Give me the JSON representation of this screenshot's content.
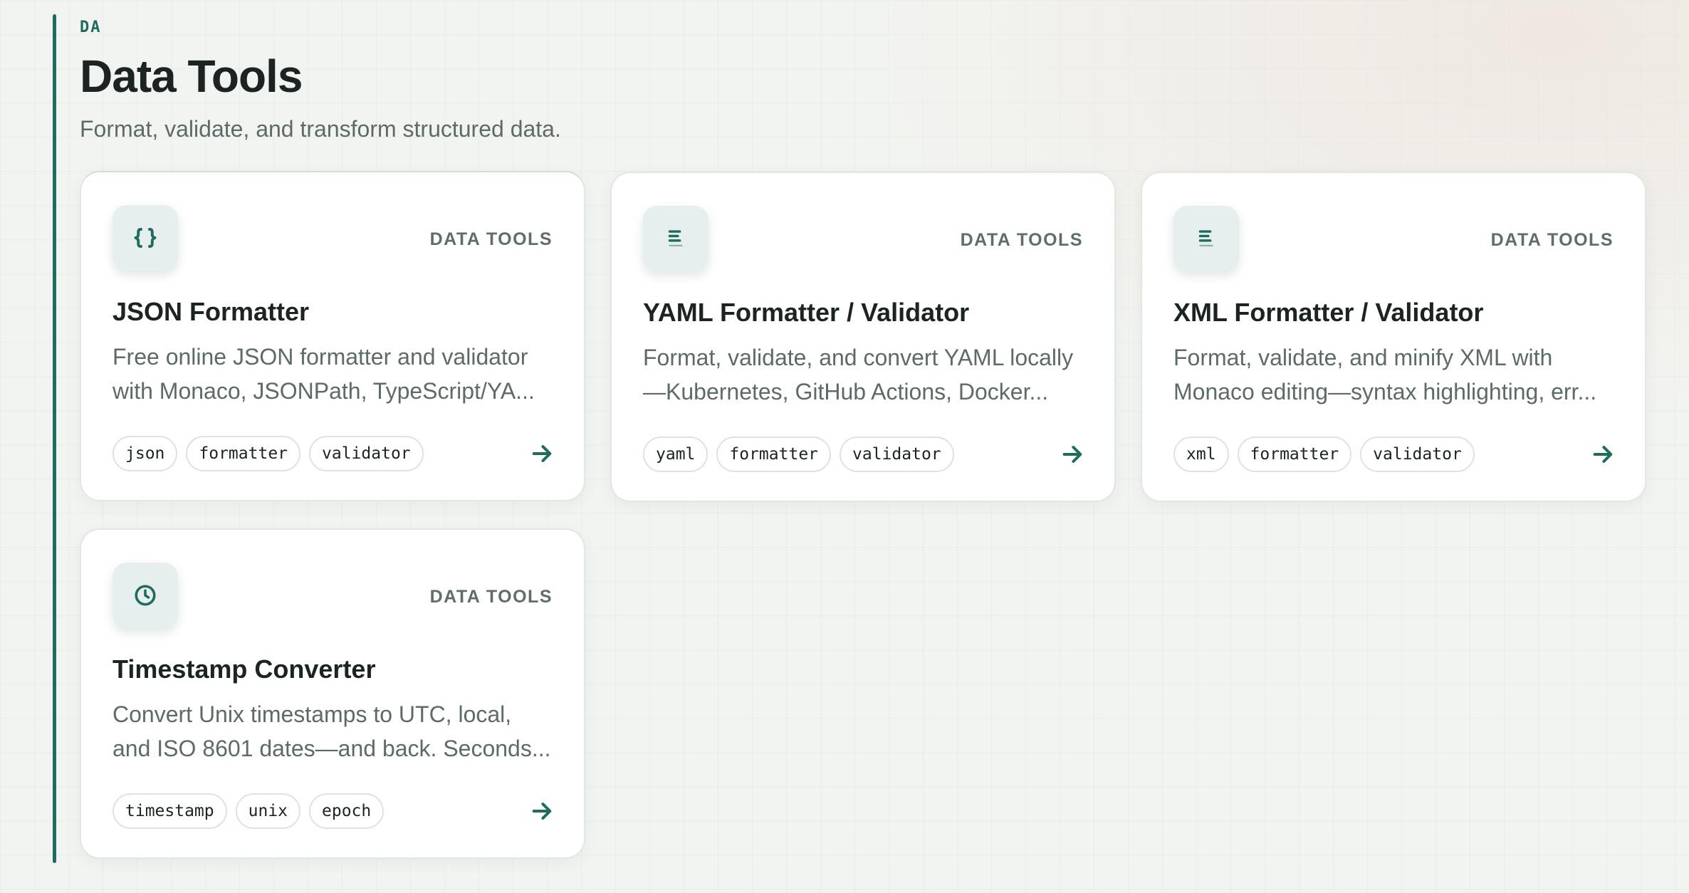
{
  "section": {
    "kicker": "DA",
    "title": "Data Tools",
    "subtitle": "Format, validate, and transform structured data."
  },
  "colors": {
    "accent": "#1f6b5e",
    "icon_bg": "#e6efed",
    "text_muted": "#5d6b66"
  },
  "cards": [
    {
      "icon": "braces-icon",
      "category": "DATA TOOLS",
      "title": "JSON Formatter",
      "description": [
        "Free online JSON formatter and validator",
        "with Monaco, JSONPath, TypeScript/YA..."
      ],
      "tags": [
        "json",
        "formatter",
        "validator"
      ]
    },
    {
      "icon": "list-lines-icon",
      "category": "DATA TOOLS",
      "title": "YAML Formatter / Validator",
      "description": [
        "Format, validate, and convert YAML locally",
        "—Kubernetes, GitHub Actions, Docker..."
      ],
      "tags": [
        "yaml",
        "formatter",
        "validator"
      ]
    },
    {
      "icon": "list-lines-icon",
      "category": "DATA TOOLS",
      "title": "XML Formatter / Validator",
      "description": [
        "Format, validate, and minify XML with",
        "Monaco editing—syntax highlighting, err..."
      ],
      "tags": [
        "xml",
        "formatter",
        "validator"
      ]
    },
    {
      "icon": "clock-icon",
      "category": "DATA TOOLS",
      "title": "Timestamp Converter",
      "description": [
        "Convert Unix timestamps to UTC, local,",
        "and ISO 8601 dates—and back. Seconds..."
      ],
      "tags": [
        "timestamp",
        "unix",
        "epoch"
      ]
    }
  ]
}
